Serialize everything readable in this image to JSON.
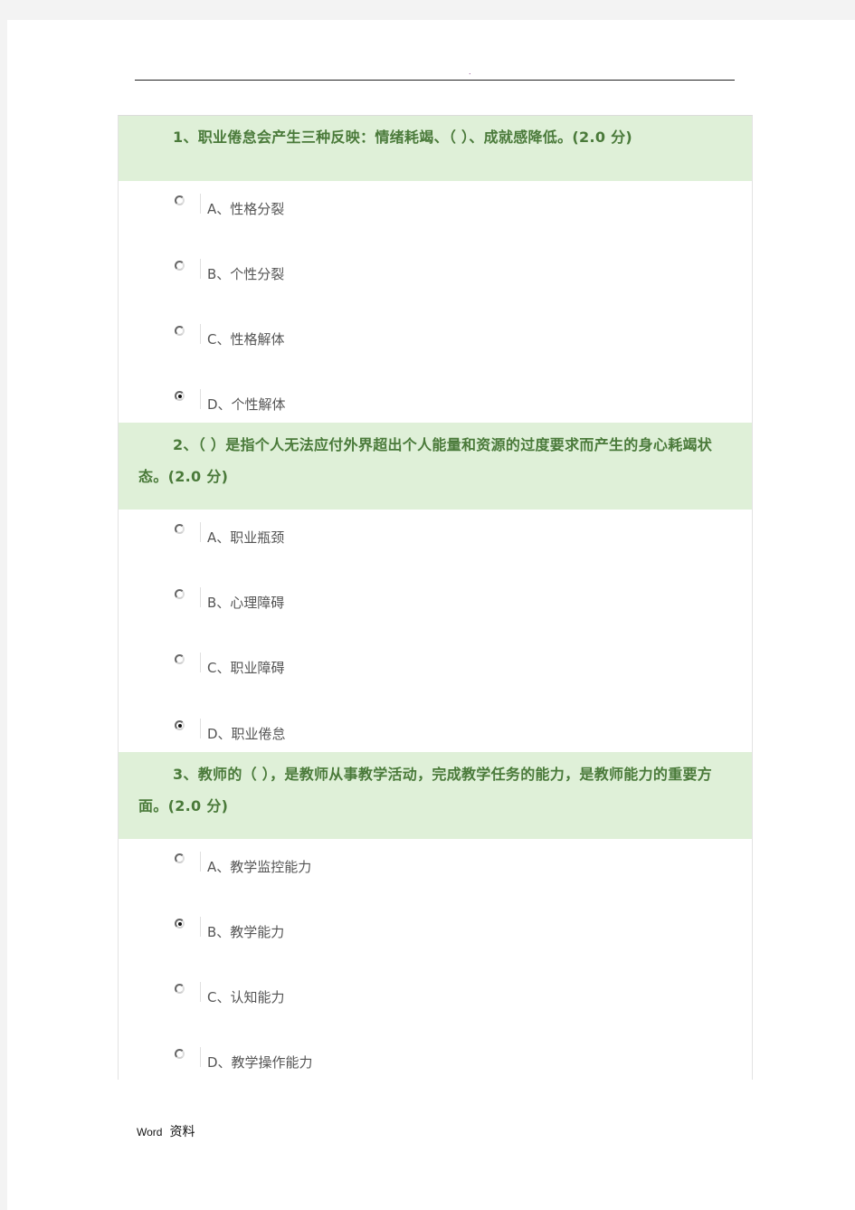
{
  "header": {
    "mark": "."
  },
  "questions": [
    {
      "number": "1",
      "text": "1、职业倦怠会产生三种反映：情绪耗竭、（ ）、成就感降低。(2.0 分)",
      "options": [
        {
          "label": "A、性格分裂",
          "selected": false
        },
        {
          "label": "B、个性分裂",
          "selected": false
        },
        {
          "label": "C、性格解体",
          "selected": false
        },
        {
          "label": "D、个性解体",
          "selected": true
        }
      ]
    },
    {
      "number": "2",
      "text": "2、（ ）是指个人无法应付外界超出个人能量和资源的过度要求而产生的身心耗竭状态。(2.0 分)",
      "options": [
        {
          "label": "A、职业瓶颈",
          "selected": false
        },
        {
          "label": "B、心理障碍",
          "selected": false
        },
        {
          "label": "C、职业障碍",
          "selected": false
        },
        {
          "label": "D、职业倦怠",
          "selected": true
        }
      ]
    },
    {
      "number": "3",
      "text": "3、教师的（ ），是教师从事教学活动，完成教学任务的能力，是教师能力的重要方面。(2.0 分)",
      "options": [
        {
          "label": "A、教学监控能力",
          "selected": false
        },
        {
          "label": "B、教学能力",
          "selected": true
        },
        {
          "label": "C、认知能力",
          "selected": false
        },
        {
          "label": "D、教学操作能力",
          "selected": false
        }
      ]
    }
  ],
  "footer": {
    "word": "Word",
    "label": "资料"
  },
  "colors": {
    "question_bg": "#dff0d8",
    "question_text": "#4a7a3a",
    "option_text": "#555555"
  }
}
